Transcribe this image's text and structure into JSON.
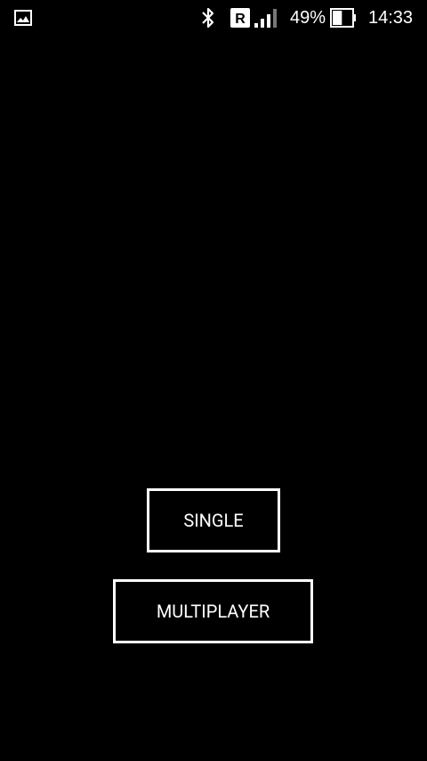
{
  "status_bar": {
    "notification_icon": "gallery-icon",
    "bluetooth_icon": "bluetooth-icon",
    "roaming_icon": "roaming-icon",
    "roaming_label": "R",
    "signal_icon": "signal-icon",
    "battery_percent": "49%",
    "battery_level": 0.49,
    "battery_icon": "battery-icon",
    "time": "14:33"
  },
  "menu": {
    "single_label": "SINGLE",
    "multiplayer_label": "MULTIPLAYER"
  },
  "colors": {
    "background": "#000000",
    "foreground": "#ffffff"
  }
}
